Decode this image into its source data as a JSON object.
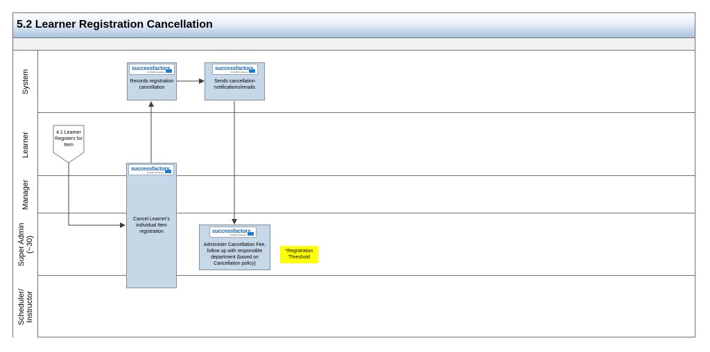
{
  "title": "5.2 Learner Registration Cancellation",
  "lanes": [
    {
      "label": "System"
    },
    {
      "label": "Learner"
    },
    {
      "label": "Manager"
    },
    {
      "label": "Super Admin\n(~30)"
    },
    {
      "label": "Scheduler/\nInstructor"
    }
  ],
  "logo": {
    "word": "successfactors",
    "sub": "An SAP Company"
  },
  "start_event": {
    "text": "4.1 Learner\nRegisters for\nItem"
  },
  "steps": {
    "records": "Records registration\ncancellation",
    "sends": "Sends cancellation\nnotifications/emails",
    "cancel": "Cancel Learner's\nindividual Item\nregistration",
    "administer": "Administer Cancellation Fee,\nfollow up with responsible\ndepartment (based on\nCancellation policy)"
  },
  "note": {
    "text": "*Registration\nThreshold",
    "color": "#ffff00"
  },
  "colors": {
    "task_fill": "#c6d7e8",
    "connector": "#404040"
  }
}
